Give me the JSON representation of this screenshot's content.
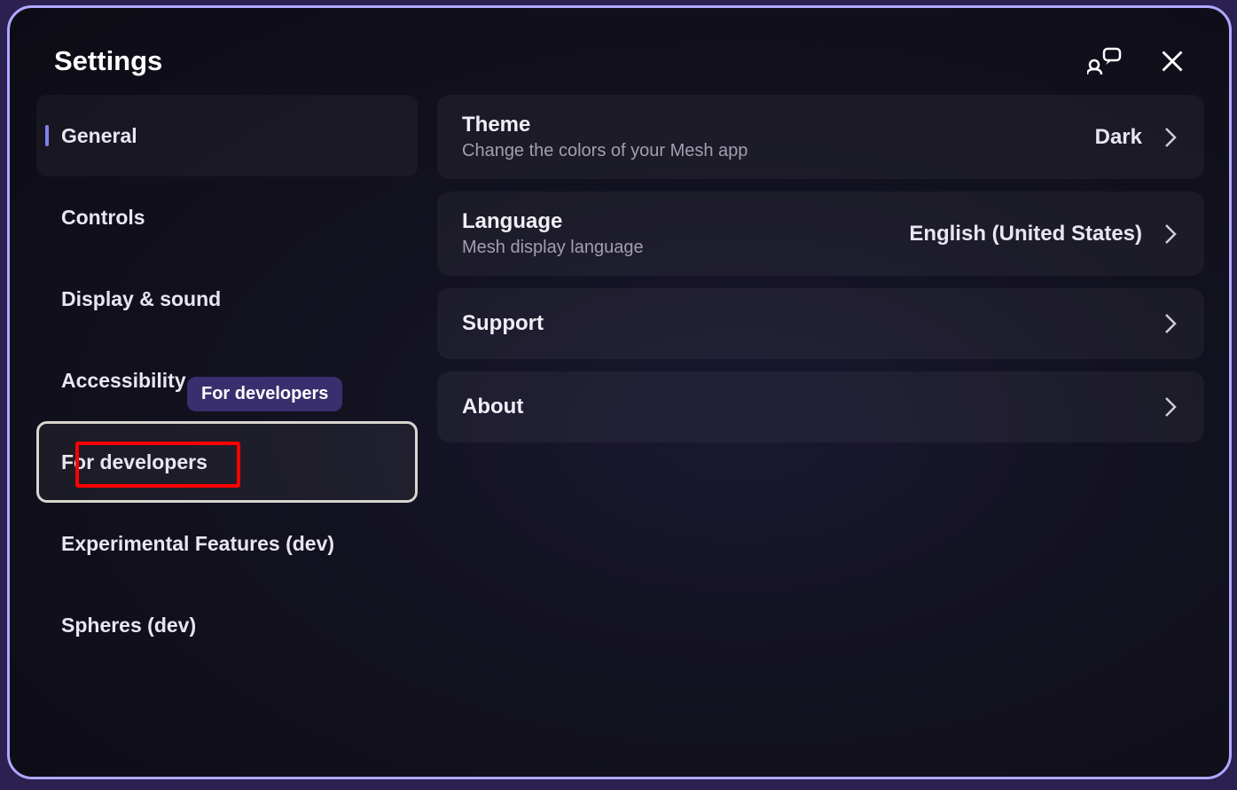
{
  "header": {
    "title": "Settings"
  },
  "sidebar": {
    "items": [
      {
        "label": "General"
      },
      {
        "label": "Controls"
      },
      {
        "label": "Display & sound"
      },
      {
        "label": "Accessibility"
      },
      {
        "label": "For developers"
      },
      {
        "label": "Experimental Features (dev)"
      },
      {
        "label": "Spheres (dev)"
      }
    ]
  },
  "tooltip": {
    "text": "For developers"
  },
  "content": {
    "items": [
      {
        "title": "Theme",
        "subtitle": "Change the colors of your Mesh app",
        "value": "Dark"
      },
      {
        "title": "Language",
        "subtitle": "Mesh display language",
        "value": "English (United States)"
      },
      {
        "title": "Support",
        "subtitle": "",
        "value": ""
      },
      {
        "title": "About",
        "subtitle": "",
        "value": ""
      }
    ]
  }
}
